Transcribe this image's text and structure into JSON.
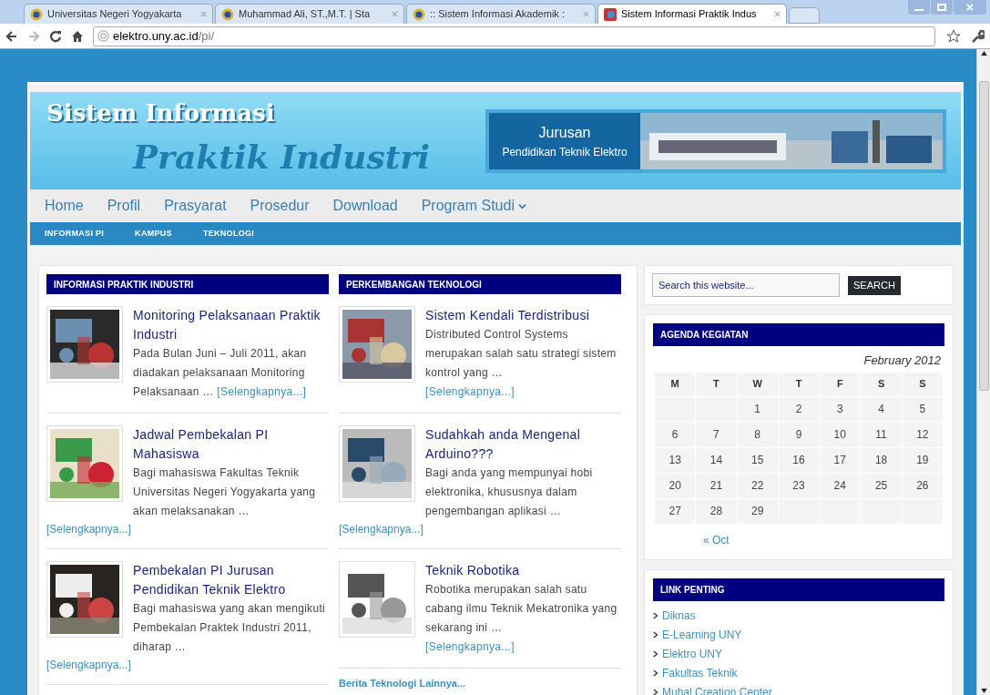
{
  "browser": {
    "tabs": [
      {
        "label": "Universitas Negeri Yogyakarta",
        "selected": false
      },
      {
        "label": "Muhammad Ali, ST.,M.T. | Sta",
        "selected": false
      },
      {
        "label": ":: Sistem Informasi Akademik :",
        "selected": false
      },
      {
        "label": "Sistem Informasi Praktik Indus",
        "selected": true
      }
    ],
    "url_host": "elektro.uny.ac.id",
    "url_path": "/pi/"
  },
  "header": {
    "title_line1": "Sistem Informasi",
    "title_line2": "Praktik Industri",
    "banner_line1": "Jurusan",
    "banner_line2": "Pendidikan Teknik Elektro"
  },
  "nav": [
    {
      "label": "Home",
      "dropdown": false
    },
    {
      "label": "Profil",
      "dropdown": false
    },
    {
      "label": "Prasyarat",
      "dropdown": false
    },
    {
      "label": "Prosedur",
      "dropdown": false
    },
    {
      "label": "Download",
      "dropdown": false
    },
    {
      "label": "Program Studi",
      "dropdown": true
    }
  ],
  "subnav": [
    "INFORMASI PI",
    "KAMPUS",
    "TEKNOLOGI"
  ],
  "columns": [
    {
      "heading": "INFORMASI PRAKTIK INDUSTRI",
      "posts": [
        {
          "title": "Monitoring Pelaksanaan Praktik Industri",
          "excerpt": "Pada Bulan Juni – Juli 2011, akan diadakan pelaksanaan Monitoring Pelaksanaan …",
          "more": "[Selengkapnya...]",
          "more_inline": true
        },
        {
          "title": "Jadwal Pembekalan PI Mahasiswa",
          "excerpt": "Bagi mahasiswa Fakultas Teknik Universitas Negeri Yogyakarta yang akan melaksanakan …",
          "more": "[Selengkapnya...]",
          "more_inline": false
        },
        {
          "title": "Pembekalan PI Jurusan Pendidikan Teknik Elektro",
          "excerpt": "Bagi mahasiswa yang akan mengikuti Pembekalan Praktek Industri 2011, diharap …",
          "more": "[Selengkapnya...]",
          "more_inline": false
        }
      ]
    },
    {
      "heading": "PERKEMBANGAN TEKNOLOGI",
      "posts": [
        {
          "title": "Sistem Kendali Terdistribusi",
          "excerpt": "Distributed Control Systems merupakan salah satu strategi sistem kontrol yang …",
          "more": "[Selengkapnya...]",
          "more_inline": true
        },
        {
          "title": "Sudahkah anda Mengenal Arduino???",
          "excerpt": "Bagi anda yang mempunyai hobi elektronika, khususnya dalam pengembangan aplikasi …",
          "more": "[Selengkapnya...]",
          "more_inline": false
        },
        {
          "title": "Teknik Robotika",
          "excerpt": "Robotika merupakan salah satu cabang ilmu Teknik Mekatronika yang sekarang ini …",
          "more": "[Selengkapnya...]",
          "more_inline": true
        }
      ],
      "footer_link": "Berita Teknologi Lainnya..."
    }
  ],
  "search": {
    "placeholder": "Search this website...",
    "button": "SEARCH"
  },
  "agenda": {
    "heading": "AGENDA KEGIATAN",
    "caption": "February 2012",
    "weekdays": [
      "M",
      "T",
      "W",
      "T",
      "F",
      "S",
      "S"
    ],
    "weeks": [
      [
        "1",
        "2",
        "3",
        "4",
        "5"
      ],
      [
        "6",
        "7",
        "8",
        "9",
        "10",
        "11",
        "12"
      ],
      [
        "13",
        "14",
        "15",
        "16",
        "17",
        "18",
        "19"
      ],
      [
        "20",
        "21",
        "22",
        "23",
        "24",
        "25",
        "26"
      ],
      [
        "27",
        "28",
        "29"
      ]
    ],
    "prev": "« Oct"
  },
  "links": {
    "heading": "LINK PENTING",
    "items": [
      "Diknas",
      "E-Learning UNY",
      "Elektro UNY",
      "Fakultas Teknik",
      "Muhal Creation Center"
    ]
  }
}
